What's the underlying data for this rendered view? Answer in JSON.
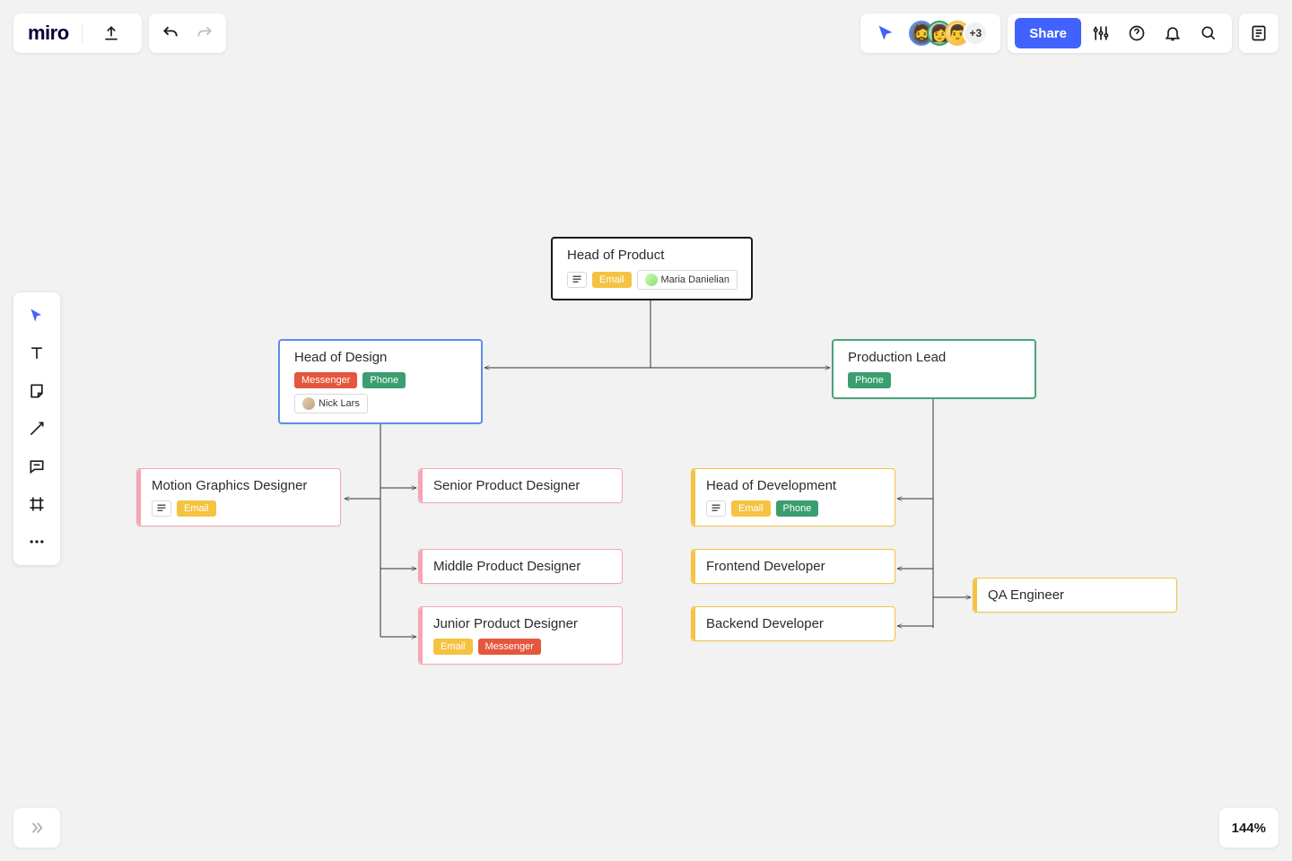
{
  "app": {
    "logo": "miro"
  },
  "header": {
    "share_label": "Share",
    "avatar_overflow": "+3"
  },
  "zoom": {
    "label": "144%"
  },
  "tags": {
    "email": "Email",
    "phone": "Phone",
    "messenger": "Messenger"
  },
  "nodes": {
    "head_product": {
      "title": "Head of Product",
      "person": "Maria Danielian"
    },
    "head_design": {
      "title": "Head of Design",
      "person": "Nick Lars"
    },
    "production_lead": {
      "title": "Production Lead"
    },
    "motion_graphics": {
      "title": "Motion Graphics Designer"
    },
    "senior_pd": {
      "title": "Senior Product Designer"
    },
    "middle_pd": {
      "title": "Middle Product Designer"
    },
    "junior_pd": {
      "title": "Junior Product Designer"
    },
    "head_dev": {
      "title": "Head of Development"
    },
    "frontend": {
      "title": "Frontend Developer"
    },
    "backend": {
      "title": "Backend Developer"
    },
    "qa": {
      "title": "QA Engineer"
    }
  }
}
